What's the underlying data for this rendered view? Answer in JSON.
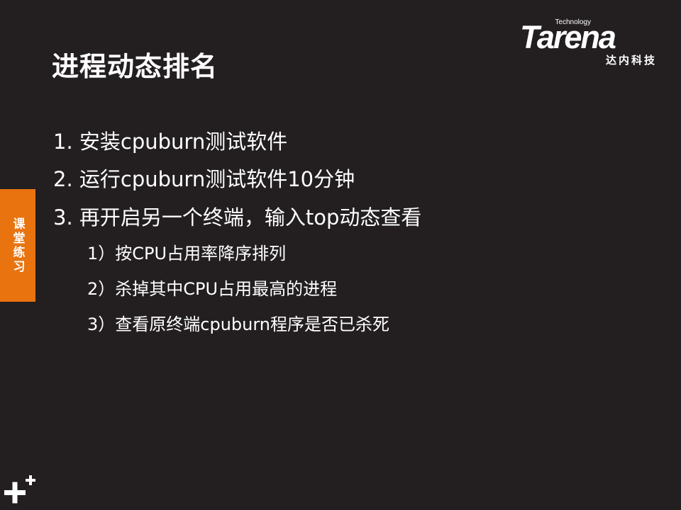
{
  "title": "进程动态排名",
  "logo": {
    "tagline": "Technology",
    "wordmark": "Tarena",
    "chinese": "达内科技"
  },
  "side_tab": {
    "label": "课堂练习",
    "color": "#e8730f"
  },
  "items": [
    "1. 安装cpuburn测试软件",
    "2. 运行cpuburn测试软件10分钟",
    "3. 再开启另一个终端，输入top动态查看"
  ],
  "subitems": [
    "1）按CPU占用率降序排列",
    "2）杀掉其中CPU占用最高的进程",
    "3）查看原终端cpuburn程序是否已杀死"
  ],
  "colors": {
    "background": "#231f20",
    "text": "#ffffff",
    "accent": "#e8730f"
  },
  "icons": {
    "corner": "plus-plus-icon"
  }
}
